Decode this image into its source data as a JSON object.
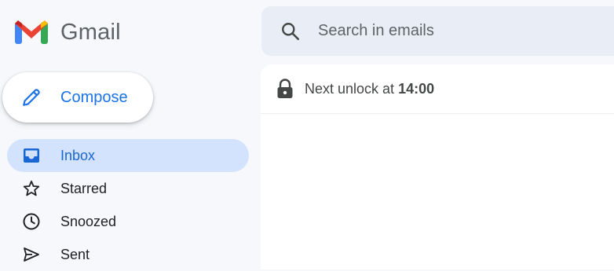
{
  "app": {
    "name": "Gmail",
    "logo_icon": "gmail-logo-icon",
    "colors": {
      "logo_red": "#ea4335",
      "logo_blue": "#4285f4",
      "logo_green": "#34a853",
      "logo_yellow": "#fbbc04",
      "logo_dark_red": "#c5221f",
      "accent": "#1a73e8",
      "active_nav_bg": "#d3e3fd"
    }
  },
  "compose": {
    "label": "Compose",
    "icon": "pencil-icon"
  },
  "sidebar": {
    "items": [
      {
        "label": "Inbox",
        "icon": "inbox-icon",
        "active": true
      },
      {
        "label": "Starred",
        "icon": "star-icon",
        "active": false
      },
      {
        "label": "Snoozed",
        "icon": "clock-icon",
        "active": false
      },
      {
        "label": "Sent",
        "icon": "send-icon",
        "active": false
      }
    ]
  },
  "search": {
    "placeholder": "Search in emails",
    "icon": "search-icon"
  },
  "notice": {
    "icon": "lock-icon",
    "prefix": "Next unlock at ",
    "time": "14:00"
  }
}
